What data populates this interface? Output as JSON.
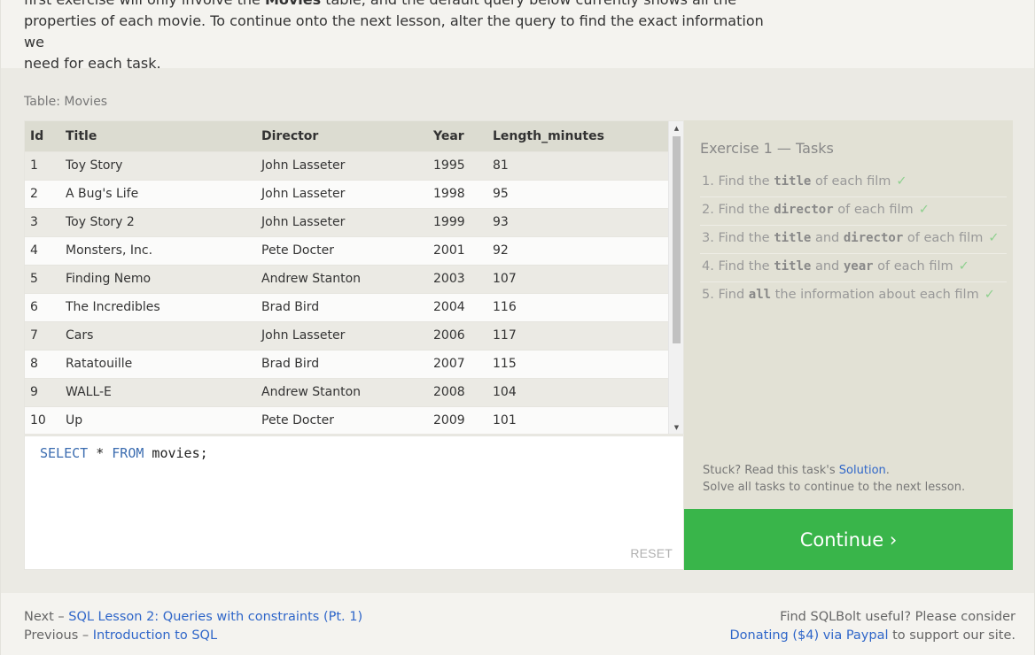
{
  "intro": {
    "line1_pre": "first exercise will only involve the ",
    "line1_bold": "Movies",
    "line1_post": " table, and the default query below currently shows all the",
    "line2": "properties of each movie. To continue onto the next lesson, alter the query to find the exact information we",
    "line3": "need for each task."
  },
  "table": {
    "caption": "Table: Movies",
    "columns": [
      "Id",
      "Title",
      "Director",
      "Year",
      "Length_minutes"
    ],
    "rows": [
      [
        "1",
        "Toy Story",
        "John Lasseter",
        "1995",
        "81"
      ],
      [
        "2",
        "A Bug's Life",
        "John Lasseter",
        "1998",
        "95"
      ],
      [
        "3",
        "Toy Story 2",
        "John Lasseter",
        "1999",
        "93"
      ],
      [
        "4",
        "Monsters, Inc.",
        "Pete Docter",
        "2001",
        "92"
      ],
      [
        "5",
        "Finding Nemo",
        "Andrew Stanton",
        "2003",
        "107"
      ],
      [
        "6",
        "The Incredibles",
        "Brad Bird",
        "2004",
        "116"
      ],
      [
        "7",
        "Cars",
        "John Lasseter",
        "2006",
        "117"
      ],
      [
        "8",
        "Ratatouille",
        "Brad Bird",
        "2007",
        "115"
      ],
      [
        "9",
        "WALL-E",
        "Andrew Stanton",
        "2008",
        "104"
      ],
      [
        "10",
        "Up",
        "Pete Docter",
        "2009",
        "101"
      ]
    ]
  },
  "editor": {
    "kw_select": "SELECT",
    "star": " * ",
    "kw_from": "FROM",
    "rest": " movies;",
    "reset_label": "RESET"
  },
  "tasks": {
    "title": "Exercise 1 — Tasks",
    "items": [
      {
        "n": "1.",
        "pre": "Find the ",
        "code1": "title",
        "mid": "",
        "code2": "",
        "post": " of each film"
      },
      {
        "n": "2.",
        "pre": "Find the ",
        "code1": "director",
        "mid": "",
        "code2": "",
        "post": " of each film"
      },
      {
        "n": "3.",
        "pre": "Find the ",
        "code1": "title",
        "mid": " and ",
        "code2": "director",
        "post": " of each film"
      },
      {
        "n": "4.",
        "pre": "Find the ",
        "code1": "title",
        "mid": " and ",
        "code2": "year",
        "post": " of each film"
      },
      {
        "n": "5.",
        "pre": "Find ",
        "code1": "all",
        "mid": "",
        "code2": "",
        "post": " the information about each film"
      }
    ],
    "check_glyph": "✓",
    "stuck_pre": "Stuck? Read this task's ",
    "stuck_link": "Solution",
    "stuck_post": ".",
    "solve_all": "Solve all tasks to continue to the next lesson."
  },
  "continue_label": "Continue ›",
  "footer": {
    "next_prefix": "Next – ",
    "next_link": "SQL Lesson 2: Queries with constraints (Pt. 1)",
    "prev_prefix": "Previous – ",
    "prev_link": "Introduction to SQL",
    "support_line1": "Find SQLBolt useful? Please consider",
    "donate_link": "Donating ($4) via Paypal",
    "support_line2_post": " to support our site."
  },
  "colors": {
    "accent_green": "#39b54a",
    "link_blue": "#2f66c9",
    "sql_keyword": "#3b6cb0"
  }
}
